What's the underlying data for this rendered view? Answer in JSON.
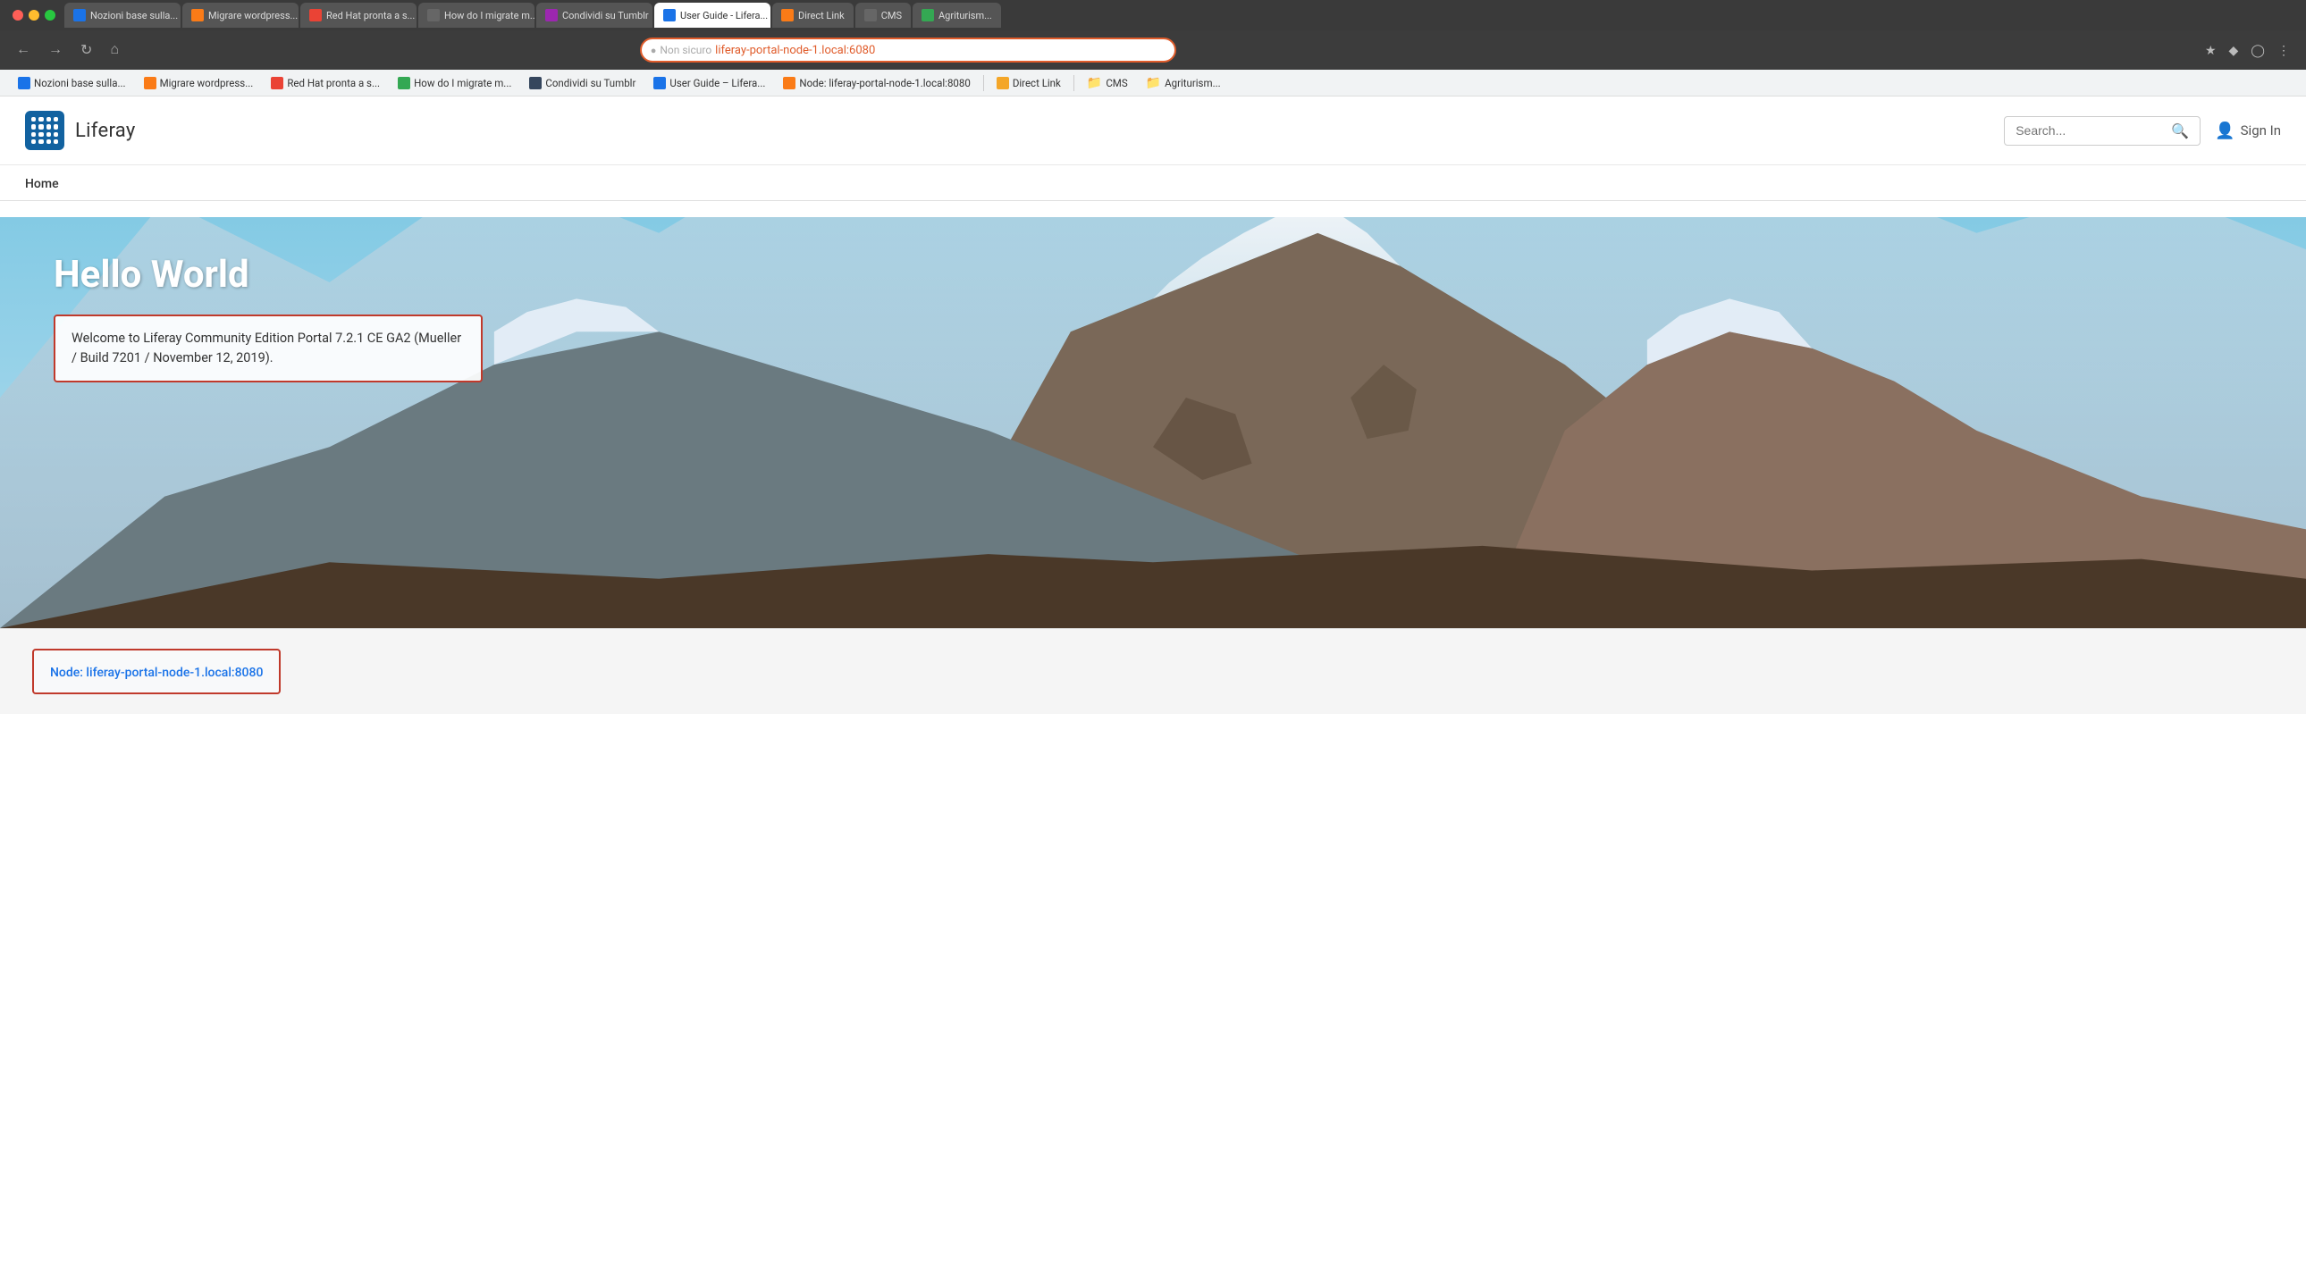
{
  "browser": {
    "url": "liferay-portal-node-1.local:6080",
    "url_prefix": "Non sicuro",
    "tabs": [
      {
        "label": "Nozioni base sulla...",
        "active": false,
        "favicon_color": "blue"
      },
      {
        "label": "Migrare wordpress...",
        "active": false,
        "favicon_color": "orange"
      },
      {
        "label": "Red Hat pronta a s...",
        "active": false,
        "favicon_color": "red"
      },
      {
        "label": "How do I migrate m...",
        "active": false,
        "favicon_color": "gray"
      },
      {
        "label": "Condividi su Tumblr",
        "active": false,
        "favicon_color": "purple"
      },
      {
        "label": "User Guide - Lifera...",
        "active": false,
        "favicon_color": "blue"
      },
      {
        "label": "Direct Link",
        "active": false,
        "favicon_color": "orange"
      },
      {
        "label": "CMS",
        "active": false,
        "favicon_color": "gray"
      },
      {
        "label": "Agriturism...",
        "active": false,
        "favicon_color": "green"
      }
    ],
    "bookmarks": [
      {
        "label": "Nozioni base sulla...",
        "type": "page",
        "color": "blue"
      },
      {
        "label": "Migrare wordpress...",
        "type": "page",
        "color": "orange"
      },
      {
        "label": "Red Hat pronta a s...",
        "type": "page",
        "color": "red"
      },
      {
        "label": "How do I migrate m...",
        "type": "page",
        "color": "green"
      },
      {
        "label": "Condividi su Tumblr",
        "type": "page",
        "color": "tumblr"
      },
      {
        "label": "User Guide – Lifera...",
        "type": "page",
        "color": "blue"
      },
      {
        "label": "Direct Link",
        "type": "page",
        "color": "orange"
      },
      {
        "label": "CMS",
        "type": "folder",
        "color": "gray"
      },
      {
        "label": "Agriturism...",
        "type": "folder",
        "color": "gray"
      }
    ]
  },
  "page": {
    "logo_text": "Liferay",
    "search_placeholder": "Search...",
    "sign_in_label": "Sign In",
    "nav": {
      "home_label": "Home"
    },
    "hero": {
      "title": "Hello World",
      "description": "Welcome to Liferay Community Edition Portal 7.2.1 CE GA2 (Mueller / Build 7201 / November 12, 2019)."
    },
    "node_bar": {
      "text": "Node: liferay-portal-node-1.local:8080"
    }
  }
}
